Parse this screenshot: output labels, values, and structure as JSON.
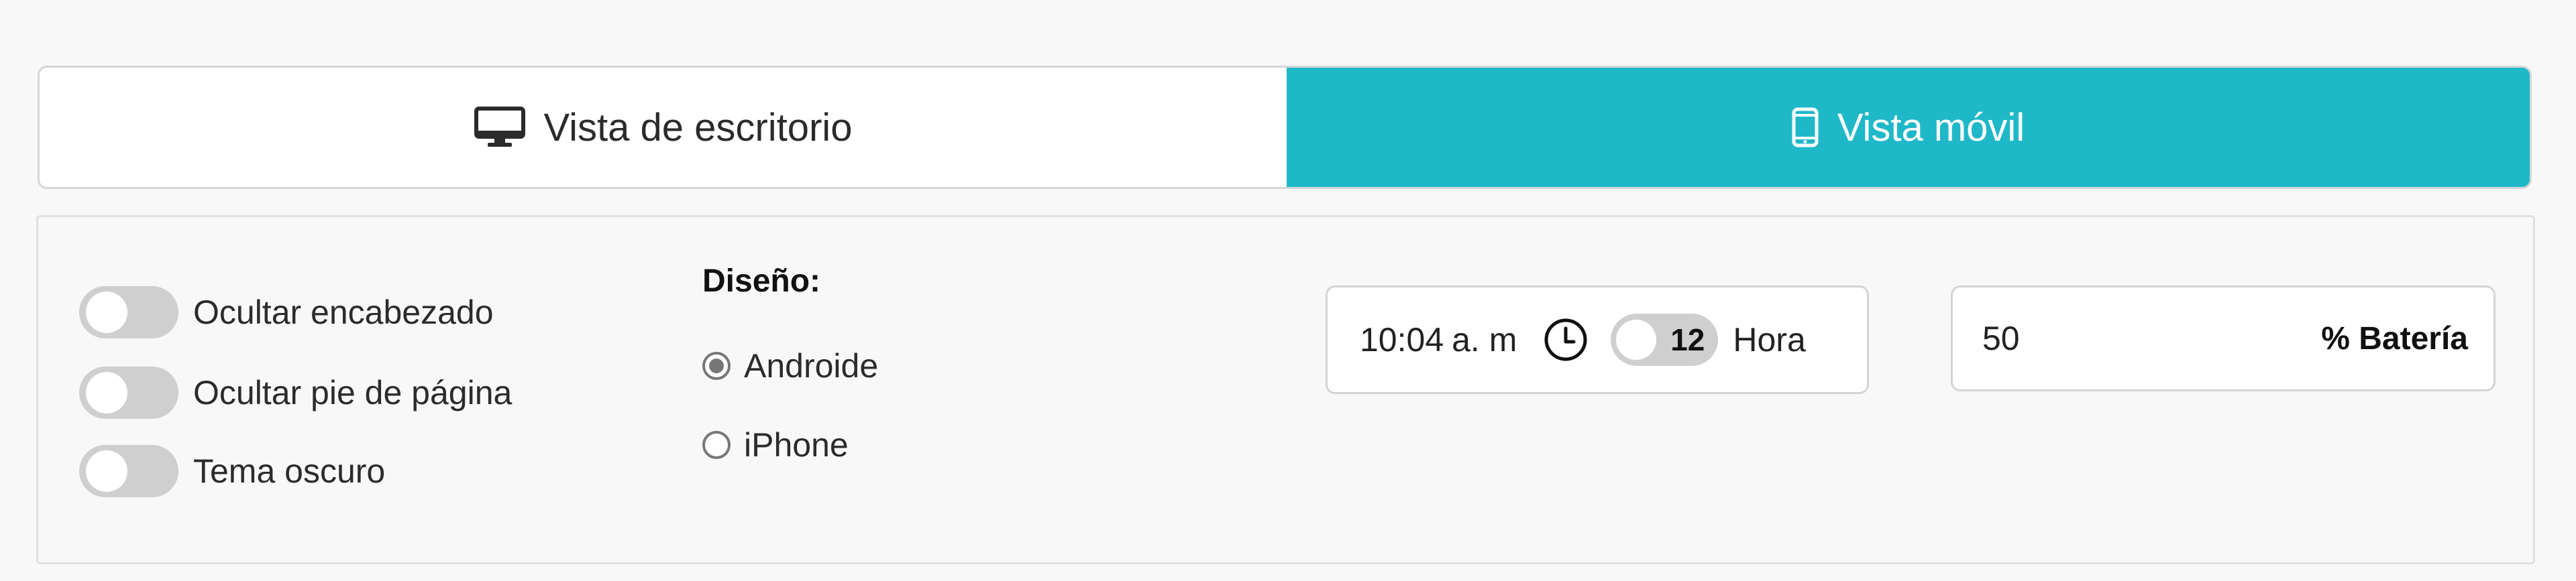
{
  "tabs": [
    {
      "label": "Vista de escritorio",
      "icon": "desktop-icon",
      "active": false
    },
    {
      "label": "Vista móvil",
      "icon": "mobile-phone-icon",
      "active": true
    }
  ],
  "colors": {
    "accent": "#1fb8c9",
    "toggle_off": "#cfcfcf",
    "panel_bg": "#f8f8f8"
  },
  "options": {
    "toggles": [
      {
        "label": "Ocultar encabezado",
        "on": false
      },
      {
        "label": "Ocultar pie de página",
        "on": false
      },
      {
        "label": "Tema oscuro",
        "on": false
      }
    ]
  },
  "design": {
    "title": "Diseño:",
    "options": [
      {
        "label": "Androide",
        "checked": true
      },
      {
        "label": "iPhone",
        "checked": false
      }
    ]
  },
  "time": {
    "value": "10:04",
    "ampm": "a. m",
    "icon": "clock-icon",
    "format_toggle_value": "12",
    "format_label": "Hora"
  },
  "battery": {
    "value": "50",
    "suffix": "% Batería"
  }
}
